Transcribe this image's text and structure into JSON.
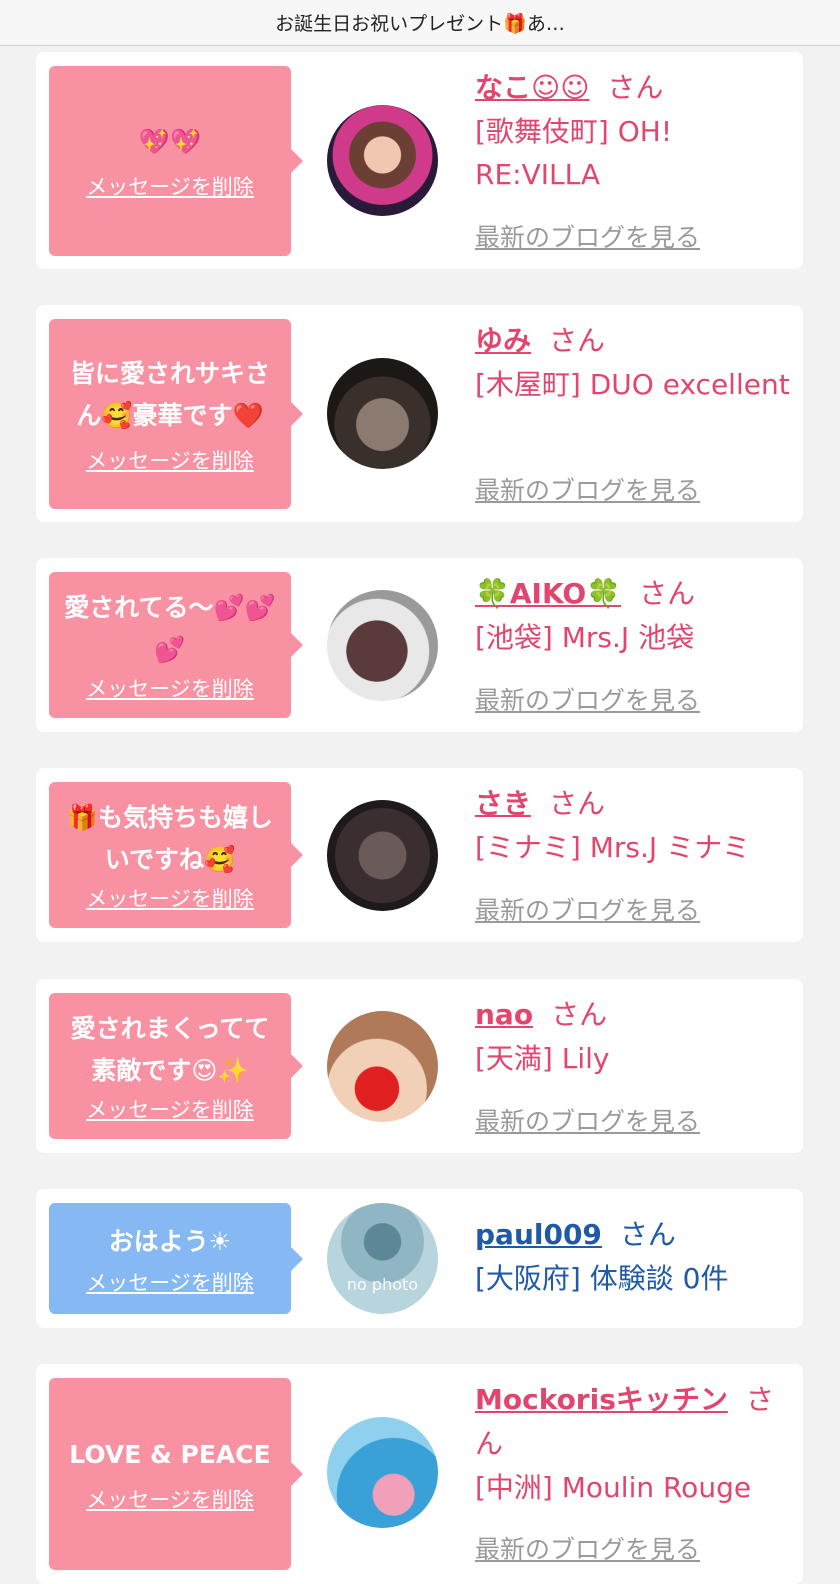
{
  "header": {
    "title": "お誕生日お祝いプレゼント🎁あ…"
  },
  "delete_label": "メッセージを削除",
  "blog_label": "最新のブログを見る",
  "honorific": "さん",
  "colors": {
    "pink_bubble": "#f892a3",
    "blue_bubble": "#86b8f3",
    "pink_text": "#e2456d",
    "blue_text": "#1f5aa6"
  },
  "cards": [
    {
      "message": "💖💖",
      "name": "なこ☺︎☺︎",
      "shop": "[歌舞伎町] OH! RE:VILLA"
    },
    {
      "message": "皆に愛されサキさん🥰豪華です❤️",
      "name": "ゆみ",
      "shop": "[木屋町] DUO excellent"
    },
    {
      "message": "愛されてる〜💕💕💕",
      "name": "🍀AIKO🍀",
      "shop": "[池袋] Mrs.J 池袋"
    },
    {
      "message": "🎁も気持ちも嬉しいですね🥰",
      "name": "さき",
      "shop": "[ミナミ] Mrs.J ミナミ"
    },
    {
      "message": "愛されまくってて素敵です😍✨",
      "name": "nao",
      "shop": "[天満] Lily"
    },
    {
      "message": "おはよう☀",
      "name": "paul009",
      "shop": "[大阪府] 体験談 0件",
      "avatar_text": "no photo"
    },
    {
      "message": "LOVE & PEACE",
      "name": "Mockorisキッチン",
      "shop": "[中洲] Moulin Rouge"
    }
  ]
}
